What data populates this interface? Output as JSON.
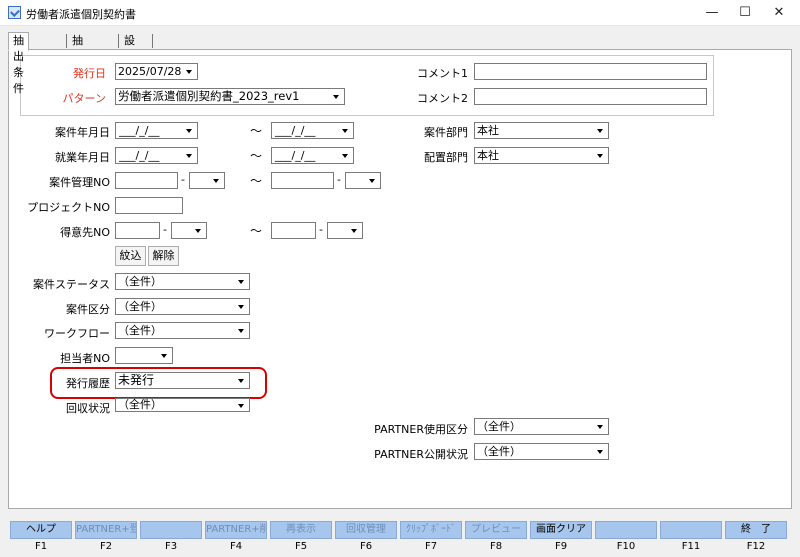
{
  "window": {
    "title": "労働者派遣個別契約書",
    "controls": {
      "minimize": "—",
      "maximize": "☐",
      "close": "✕"
    }
  },
  "tabs": [
    {
      "label": "抽出条件",
      "active": true
    },
    {
      "label": "抽出結果",
      "active": false
    },
    {
      "label": "設定",
      "active": false
    }
  ],
  "header": {
    "issue_date_label": "発行日",
    "issue_date_value": "2025/07/28",
    "pattern_label": "パターン",
    "pattern_value": "労働者派遣個別契約書_2023_rev1",
    "comment1_label": "コメント1",
    "comment1_value": "",
    "comment2_label": "コメント2",
    "comment2_value": ""
  },
  "form": {
    "case_ym_label": "案件年月日",
    "work_ym_label": "就業年月日",
    "case_no_label": "案件管理NO",
    "project_no_label": "プロジェクトNO",
    "client_no_label": "得意先NO",
    "date_mask": "___/_/__",
    "tilde": "～",
    "dash": "-",
    "case_dept_label": "案件部門",
    "case_dept_value": "本社",
    "assign_dept_label": "配置部門",
    "assign_dept_value": "本社",
    "filter_button": "紋込",
    "clear_button": "解除",
    "case_status_label": "案件ステータス",
    "case_status_value": "（全件）",
    "case_class_label": "案件区分",
    "case_class_value": "（全件）",
    "workflow_label": "ワークフロー",
    "workflow_value": "（全件）",
    "staff_no_label": "担当者NO",
    "staff_no_value": "",
    "issue_history_label": "発行履歴",
    "issue_history_value": "未発行",
    "collect_status_label": "回収状況",
    "collect_status_value": "（全件）",
    "partner_use_label": "PARTNER使用区分",
    "partner_use_value": "（全件）",
    "partner_pub_label": "PARTNER公開状況",
    "partner_pub_value": "（全件）"
  },
  "function_keys": [
    {
      "label": "ヘルプ",
      "key": "F1"
    },
    {
      "label": "PARTNER+登録",
      "key": "F2"
    },
    {
      "label": "",
      "key": "F3"
    },
    {
      "label": "PARTNER+削除",
      "key": "F4"
    },
    {
      "label": "再表示",
      "key": "F5"
    },
    {
      "label": "回収管理",
      "key": "F6"
    },
    {
      "label": "ｸﾘｯﾌﾟﾎﾞｰﾄﾞ",
      "key": "F7"
    },
    {
      "label": "プレビュー",
      "key": "F8"
    },
    {
      "label": "画面クリア",
      "key": "F9"
    },
    {
      "label": "",
      "key": "F10"
    },
    {
      "label": "",
      "key": "F11"
    },
    {
      "label": "終　了",
      "key": "F12"
    }
  ]
}
